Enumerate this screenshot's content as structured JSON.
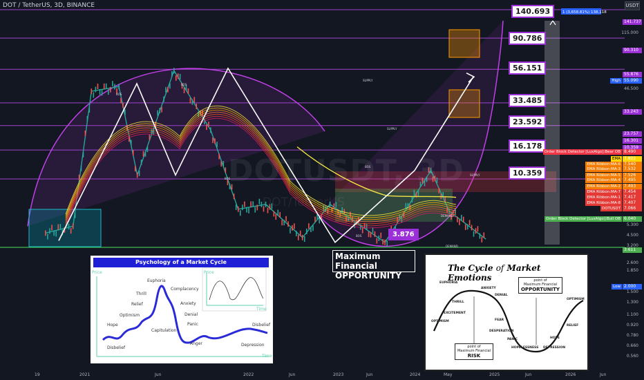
{
  "header": {
    "symbol": "DOT / TetherUS, 3D, BINANCE",
    "quote_currency": "USDT"
  },
  "watermark": {
    "main": "DOTUSDT, 3D",
    "sub": "DOT/TetherUS"
  },
  "colors": {
    "background": "#131722",
    "level_line": "#b64de8",
    "green_line": "#3fbf52",
    "price_tag_border": "#9b30d9",
    "arc": "#c040e8"
  },
  "chart_data": {
    "type": "candlestick",
    "symbol": "DOT/USDT",
    "interval": "3D",
    "exchange": "BINANCE",
    "scale": "log",
    "y_range": [
      0.56,
      200
    ],
    "x_labels": [
      "19",
      "2021",
      "Jun",
      "2022",
      "Jun",
      "2023",
      "Jun",
      "2024",
      "May",
      "2025",
      "Jun",
      "2026",
      "Jun"
    ],
    "y_ticks": [
      115.0,
      46.5,
      5.3,
      4.5,
      3.2,
      2.6,
      1.85,
      1.5,
      1.3,
      1.1,
      0.92,
      0.78,
      0.66,
      0.56
    ],
    "price_path": [
      {
        "date": "2020-09",
        "price": 4.5
      },
      {
        "date": "2020-12",
        "price": 5.0
      },
      {
        "date": "2021-02",
        "price": 40
      },
      {
        "date": "2021-05",
        "price": 43
      },
      {
        "date": "2021-07",
        "price": 11
      },
      {
        "date": "2021-11",
        "price": 55
      },
      {
        "date": "2022-03",
        "price": 22
      },
      {
        "date": "2022-06",
        "price": 6.5
      },
      {
        "date": "2022-09",
        "price": 7.0
      },
      {
        "date": "2023-01",
        "price": 4.2
      },
      {
        "date": "2023-04",
        "price": 7.0
      },
      {
        "date": "2023-10",
        "price": 3.9
      },
      {
        "date": "2024-03",
        "price": 11.8
      },
      {
        "date": "2024-05",
        "price": 6.3
      },
      {
        "date": "2024-09",
        "price": 4.1
      }
    ],
    "target_levels": [
      140.693,
      90.786,
      56.151,
      33.485,
      23.592,
      16.178,
      10.359,
      3.876
    ],
    "price_scale_labels": [
      {
        "value": "141.737",
        "color": "#9b30d9"
      },
      {
        "value": "90.310",
        "color": "#9b30d9"
      },
      {
        "value": "55.876",
        "color": "#9b30d9"
      },
      {
        "value": "55.090",
        "color": "#2962ff"
      },
      {
        "value": "33.243",
        "color": "#9b30d9"
      },
      {
        "value": "23.757",
        "color": "#9b30d9"
      },
      {
        "value": "16.301",
        "color": "#9b30d9"
      },
      {
        "value": "10.359",
        "color": "#9b30d9"
      },
      {
        "value": "8.490",
        "color": "#f23645"
      },
      {
        "value": "7.802",
        "color": "#ffd600"
      },
      {
        "value": "7.540",
        "color": "#f57c00"
      },
      {
        "value": "7.532",
        "color": "#f57c00"
      },
      {
        "value": "7.526",
        "color": "#f57c00"
      },
      {
        "value": "7.495",
        "color": "#f57c00"
      },
      {
        "value": "7.493",
        "color": "#f57c00"
      },
      {
        "value": "7.454",
        "color": "#e53935"
      },
      {
        "value": "7.417",
        "color": "#e53935"
      },
      {
        "value": "7.407",
        "color": "#e53935"
      },
      {
        "value": "7.066",
        "color": "#e53935"
      },
      {
        "value": "6.040",
        "color": "#4caf50"
      },
      {
        "value": "3.611",
        "color": "#4caf50"
      },
      {
        "value": "2.000",
        "color": "#2962ff"
      }
    ],
    "indicator_labels": [
      {
        "name": "Order Block Detector [LuxAlgo]:Bear OB",
        "color": "#f23645"
      },
      {
        "name": "EMA",
        "color": "#ffd600"
      },
      {
        "name": "EMA Ribbon:MA-6",
        "color": "#f57c00"
      },
      {
        "name": "EMA Ribbon:MA-3",
        "color": "#f57c00"
      },
      {
        "name": "EMA Ribbon:MA-5",
        "color": "#f57c00"
      },
      {
        "name": "EMA Ribbon:MA-4",
        "color": "#f57c00"
      },
      {
        "name": "EMA Ribbon:MA-2",
        "color": "#f57c00"
      },
      {
        "name": "EMA Ribbon:MA-7",
        "color": "#e53935"
      },
      {
        "name": "EMA Ribbon:MA-1",
        "color": "#e53935"
      },
      {
        "name": "EMA Ribbon:MA-8",
        "color": "#e53935"
      },
      {
        "name": "DOTUSDT",
        "color": "#e53935"
      },
      {
        "name": "Order Block Detector [LuxAlgo]:Bull OB",
        "color": "#4caf50"
      }
    ],
    "high_label": "High",
    "low_label": "Low",
    "measure_label": "1 (3,658.81%) 138,118",
    "zone_labels": [
      "SUPPLY",
      "DEMAND",
      "BOS"
    ]
  },
  "annotation": {
    "line1": "Maximum Financial",
    "line2": "OPPORTUNITY"
  },
  "inset_psychology": {
    "title": "Psychology of a Market Cycle",
    "axis_y": "Price",
    "axis_x": "Time",
    "small_axis_y": "Price",
    "small_axis_x": "Time",
    "labels": [
      "Euphoria",
      "Complacency",
      "Thrill",
      "Anxiety",
      "Relief",
      "Denial",
      "Optimism",
      "Panic",
      "Hope",
      "Capitulation",
      "Disbelief",
      "Anger",
      "Depression",
      "Disbelief"
    ]
  },
  "inset_emotions": {
    "title_prefix": "The Cycle",
    "title_mid": "of",
    "title_suffix": "Market Emotions",
    "top_point": "point of",
    "top_main1": "Maximum Financial",
    "top_main2": "OPPORTUNITY",
    "bottom_point": "point of",
    "bottom_main1": "Maximum Financial",
    "bottom_main2": "RISK",
    "labels": [
      "EUPHORIA",
      "ANXIETY",
      "THRILL",
      "DENIAL",
      "EXCITEMENT",
      "OPTIMISM",
      "FEAR",
      "DESPERATION",
      "PANIC",
      "HOPELESSNESS",
      "DEPRESSION",
      "HOPE",
      "RELIEF",
      "OPTIMISM"
    ]
  }
}
